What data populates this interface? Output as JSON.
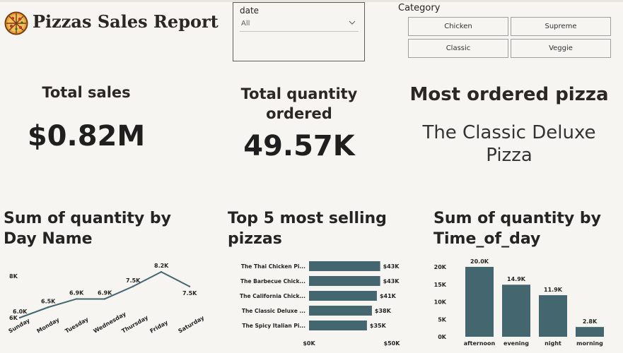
{
  "header": {
    "title": "Pizzas Sales Report"
  },
  "date_slicer": {
    "label": "date",
    "selected": "All"
  },
  "category_slicer": {
    "label": "Category",
    "options": [
      "Chicken",
      "Supreme",
      "Classic",
      "Veggie"
    ]
  },
  "kpis": {
    "total_sales": {
      "title": "Total sales",
      "value": "$0.82M"
    },
    "total_quantity": {
      "title_line1": "Total quantity",
      "title_line2": "ordered",
      "value": "49.57K"
    },
    "most_ordered": {
      "title": "Most ordered pizza",
      "value_line1": "The Classic Deluxe",
      "value_line2": "Pizza"
    }
  },
  "visual_titles": {
    "day_chart_line1": "Sum of quantity by",
    "day_chart_line2": "Day Name",
    "top5_line1": "Top 5 most selling",
    "top5_line2": "pizzas",
    "time_chart_line1": "Sum of quantity by",
    "time_chart_line2": "Time_of_day"
  },
  "chart_data": [
    {
      "type": "line",
      "title": "Sum of quantity by Day Name",
      "categories": [
        "Sunday",
        "Monday",
        "Tuesday",
        "Wednesday",
        "Thursday",
        "Friday",
        "Saturday"
      ],
      "values": [
        6.0,
        6.5,
        6.9,
        6.9,
        7.5,
        8.2,
        7.5
      ],
      "data_labels": [
        "6.0K",
        "6.5K",
        "6.9K",
        "6.9K",
        "7.5K",
        "8.2K",
        "7.5K"
      ],
      "y_ticks": [
        "8K",
        "6K"
      ],
      "ylim": [
        6,
        8
      ],
      "color": "#44666f"
    },
    {
      "type": "bar",
      "orientation": "horizontal",
      "title": "Top 5 most selling pizzas",
      "categories": [
        "The Thai Chicken Pi...",
        "The Barbecue Chick...",
        "The California Chick...",
        "The Classic Deluxe ...",
        "The Spicy Italian Pi..."
      ],
      "values": [
        43,
        43,
        41,
        38,
        35
      ],
      "data_labels": [
        "$43K",
        "$43K",
        "$41K",
        "$38K",
        "$35K"
      ],
      "x_ticks": [
        "$0K",
        "$50K"
      ],
      "xlim": [
        0,
        50
      ],
      "color": "#44666f"
    },
    {
      "type": "bar",
      "title": "Sum of quantity by Time_of_day",
      "categories": [
        "afternoon",
        "evening",
        "night",
        "morning"
      ],
      "values": [
        20.0,
        14.9,
        11.9,
        2.8
      ],
      "data_labels": [
        "20.0K",
        "14.9K",
        "11.9K",
        "2.8K"
      ],
      "y_ticks": [
        "20K",
        "15K",
        "10K",
        "5K",
        "0K"
      ],
      "ylim": [
        0,
        20
      ],
      "color": "#44666f"
    }
  ]
}
